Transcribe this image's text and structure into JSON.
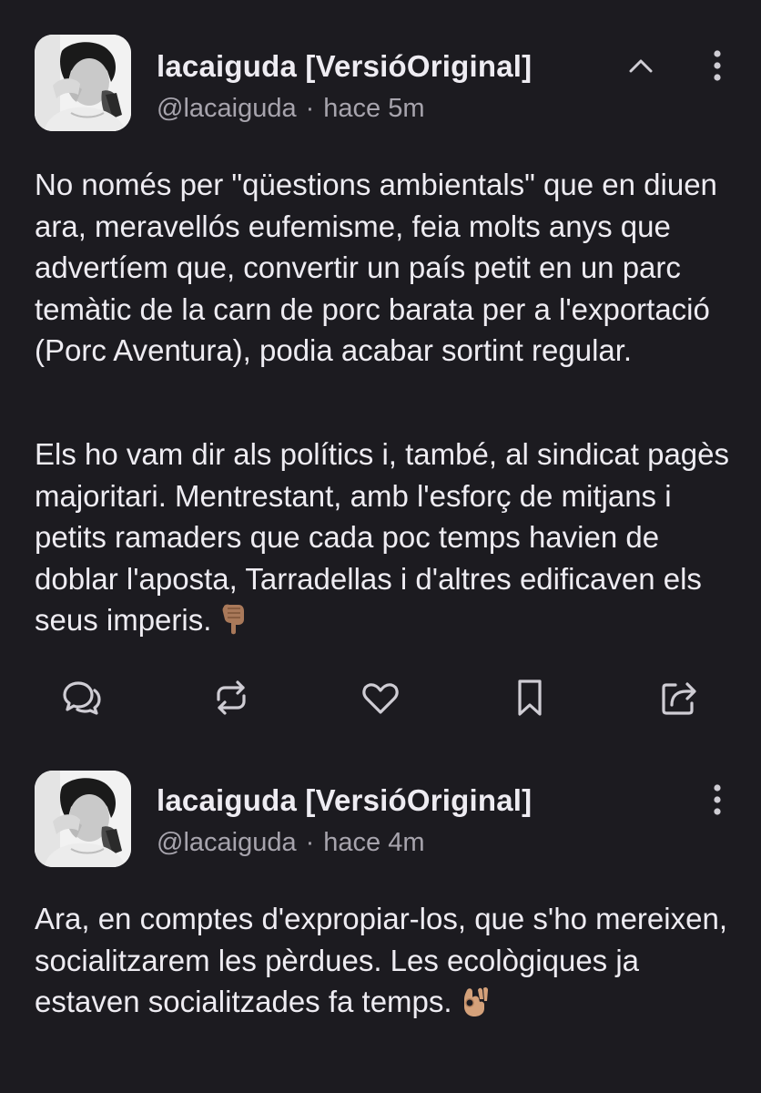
{
  "colors": {
    "background": "#1c1b20",
    "text_primary": "#eeecf2",
    "text_secondary": "#a7a4ad",
    "icon": "#cfcdd4"
  },
  "posts": [
    {
      "display_name": "lacaiguda [VersióOriginal]",
      "handle": "@lacaiguda",
      "separator": "·",
      "time": "hace 5m",
      "avatar_icon": "profile-photo",
      "header_icons": [
        "chevron-up-icon",
        "more-vertical-icon"
      ],
      "paragraphs": [
        "No només per \"qüestions ambientals\" que en diuen ara, meravellós eufemisme, feia molts anys que advertíem que, convertir un país petit en un parc temàtic de la carn de porc barata per a l'exportació (Porc Aventura), podia acabar sortint regular.",
        "Els ho vam dir als polítics i, també, al sindicat pagès majoritari. Mentrestant, amb l'esforç de mitjans i petits ramaders que cada poc temps havien de doblar l'aposta, Tarradellas i d'altres edificaven els seus imperis."
      ],
      "trailing_emoji": "👇🏽",
      "actions": [
        "reply-icon",
        "boost-icon",
        "favourite-icon",
        "bookmark-icon",
        "share-icon"
      ]
    },
    {
      "display_name": "lacaiguda [VersióOriginal]",
      "handle": "@lacaiguda",
      "separator": "·",
      "time": "hace 4m",
      "avatar_icon": "profile-photo",
      "header_icons": [
        "more-vertical-icon"
      ],
      "paragraphs": [
        "Ara, en comptes d'expropiar-los, que s'ho mereixen, socialitzarem les pèrdues. Les ecològiques ja estaven socialitzades fa temps."
      ],
      "trailing_emoji": "👌🏽"
    }
  ]
}
